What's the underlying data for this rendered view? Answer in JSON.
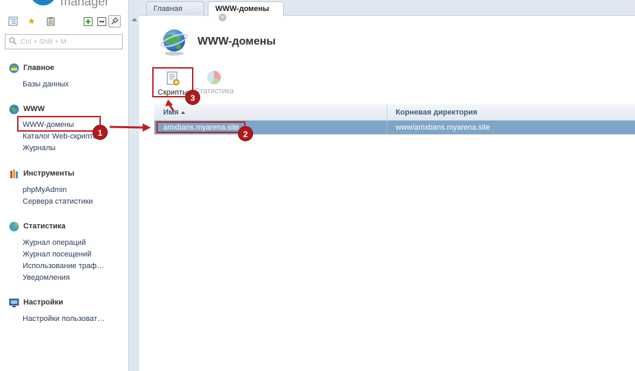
{
  "app": {
    "logo_text": "manager"
  },
  "search": {
    "placeholder": "Ctrl + Shift + M"
  },
  "sidebar": {
    "sections": [
      {
        "title": "Главное",
        "icon": "home-icon",
        "items": [
          "Базы данных"
        ]
      },
      {
        "title": "WWW",
        "icon": "globe-icon",
        "items": [
          "WWW-домены",
          "Каталог Web-скриптов",
          "Журналы"
        ]
      },
      {
        "title": "Инструменты",
        "icon": "tools-icon",
        "items": [
          "phpMyAdmin",
          "Сервера статистики"
        ]
      },
      {
        "title": "Статистика",
        "icon": "stats-icon",
        "items": [
          "Журнал операций",
          "Журнал посещений",
          "Использование траф…",
          "Уведомления"
        ]
      },
      {
        "title": "Настройки",
        "icon": "settings-icon",
        "items": [
          "Настройки пользоват…"
        ]
      }
    ]
  },
  "tabs": [
    {
      "label": "Главная",
      "active": false
    },
    {
      "label": "WWW-домены",
      "active": true,
      "closable": true
    }
  ],
  "page": {
    "title": "WWW-домены"
  },
  "toolbar": {
    "scripts_label": "Скрипты",
    "stats_label": "Статистика"
  },
  "grid": {
    "columns": [
      "Имя",
      "Корневая директория"
    ],
    "rows": [
      {
        "name": "amxbans.myarena.site",
        "root": "www/amxbans.myarena.site",
        "selected": true
      }
    ]
  },
  "annotations": {
    "badge1": "1",
    "badge2": "2",
    "badge3": "3"
  },
  "colors": {
    "accent_red": "#b3191c",
    "selected_row": "#7ea5c8",
    "header_text": "#3d5a80"
  }
}
